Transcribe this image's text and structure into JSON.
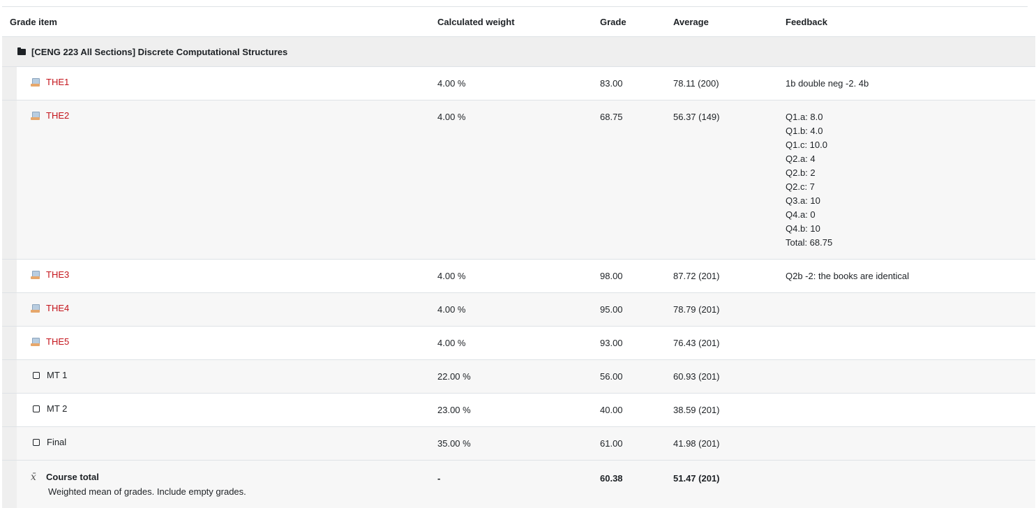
{
  "headers": {
    "grade_item": "Grade item",
    "calculated_weight": "Calculated weight",
    "grade": "Grade",
    "average": "Average",
    "feedback": "Feedback"
  },
  "category": {
    "name": "[CENG 223 All Sections] Discrete Computational Structures"
  },
  "rows": [
    {
      "name": "THE1",
      "type": "assignment",
      "weight": "4.00 %",
      "grade": "83.00",
      "average": "78.11 (200)",
      "feedback": "1b double neg -2. 4b"
    },
    {
      "name": "THE2",
      "type": "assignment",
      "weight": "4.00 %",
      "grade": "68.75",
      "average": "56.37 (149)",
      "feedback": "Q1.a: 8.0\nQ1.b: 4.0\nQ1.c: 10.0\nQ2.a: 4\nQ2.b: 2\nQ2.c: 7\nQ3.a: 10\nQ4.a: 0\nQ4.b: 10\nTotal: 68.75"
    },
    {
      "name": "THE3",
      "type": "assignment",
      "weight": "4.00 %",
      "grade": "98.00",
      "average": "87.72 (201)",
      "feedback": "Q2b -2: the books are identical"
    },
    {
      "name": "THE4",
      "type": "assignment",
      "weight": "4.00 %",
      "grade": "95.00",
      "average": "78.79 (201)",
      "feedback": ""
    },
    {
      "name": "THE5",
      "type": "assignment",
      "weight": "4.00 %",
      "grade": "93.00",
      "average": "76.43 (201)",
      "feedback": ""
    },
    {
      "name": "MT 1",
      "type": "manual",
      "weight": "22.00 %",
      "grade": "56.00",
      "average": "60.93 (201)",
      "feedback": ""
    },
    {
      "name": "MT 2",
      "type": "manual",
      "weight": "23.00 %",
      "grade": "40.00",
      "average": "38.59 (201)",
      "feedback": ""
    },
    {
      "name": "Final",
      "type": "manual",
      "weight": "35.00 %",
      "grade": "61.00",
      "average": "41.98 (201)",
      "feedback": ""
    }
  ],
  "total": {
    "name": "Course total",
    "description": "Weighted mean of grades. Include empty grades.",
    "weight": "-",
    "grade": "60.38",
    "average": "51.47 (201)"
  },
  "colors": {
    "link": "#c4141b",
    "category_bg": "#efefef"
  }
}
